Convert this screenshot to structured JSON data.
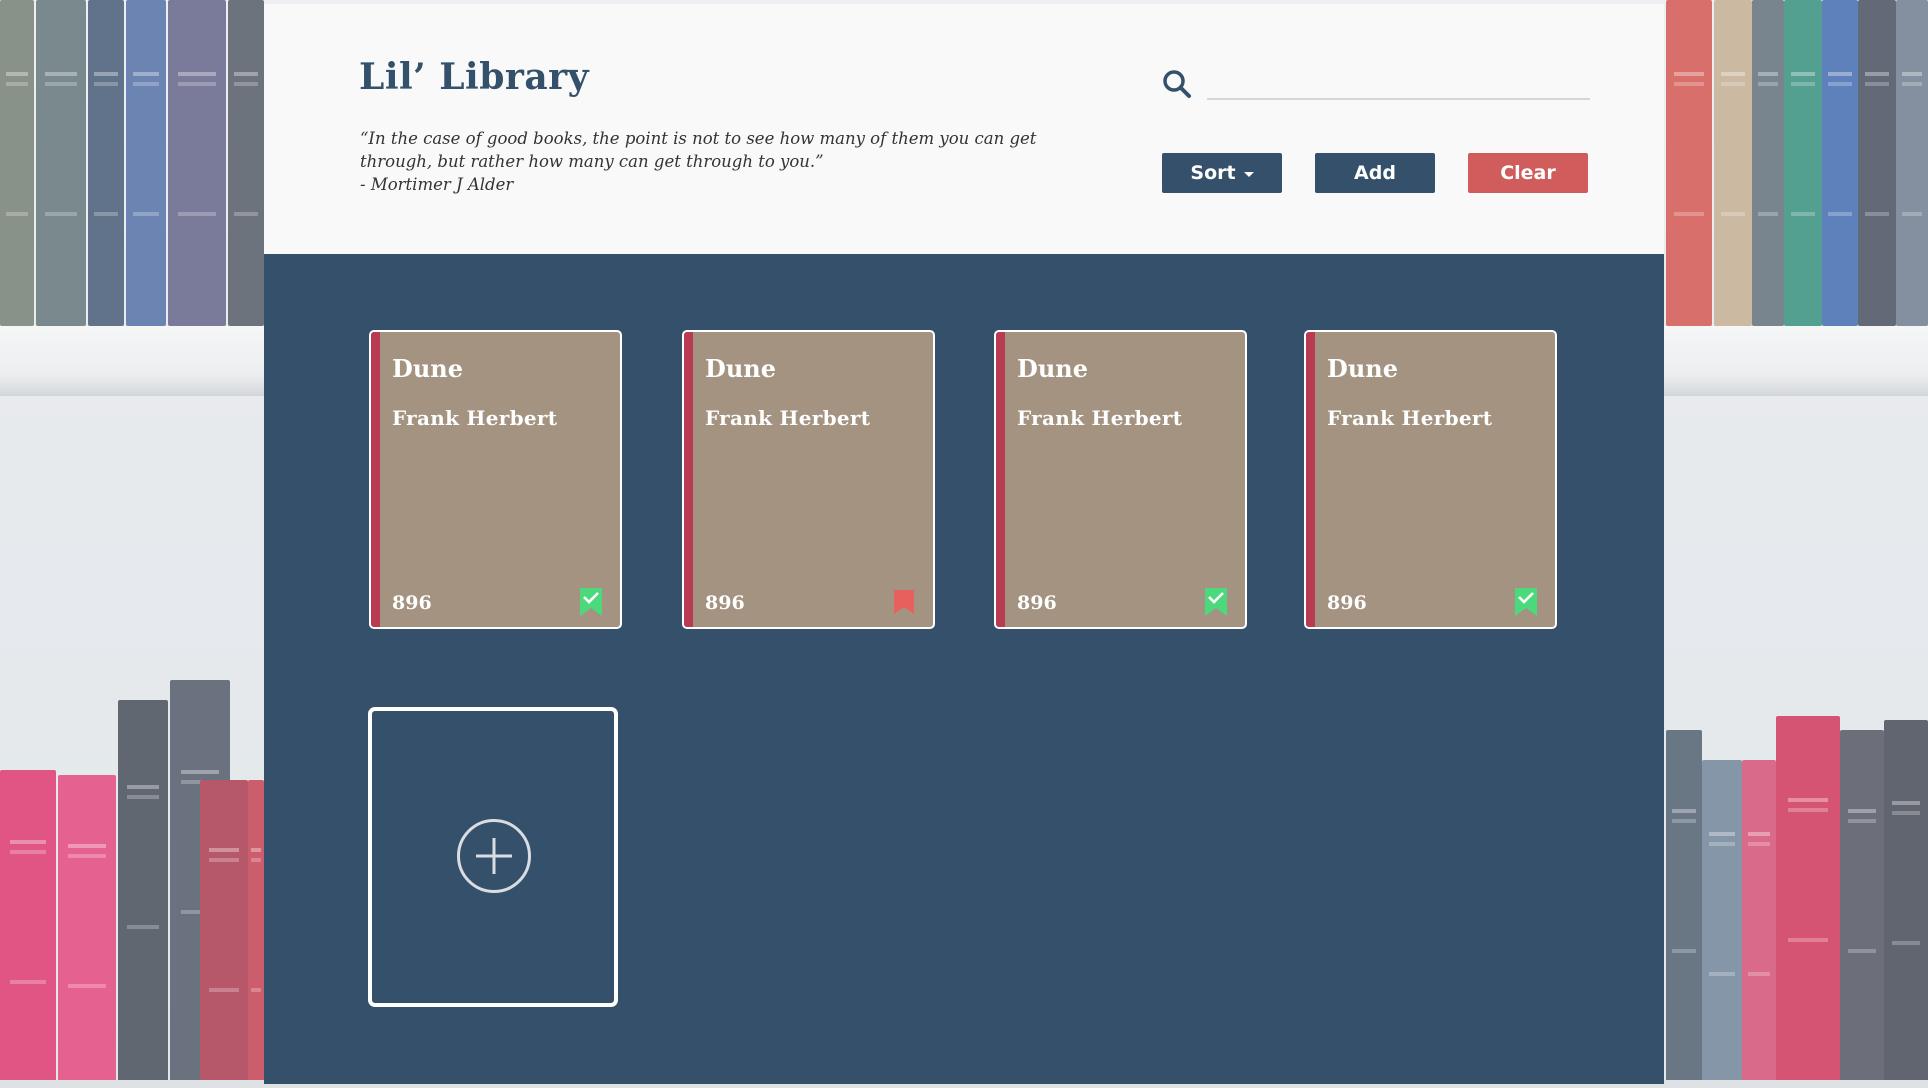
{
  "app": {
    "title": "Lil’ Library",
    "quote_lines": [
      "“In the case of good books, the point is not to see how many of them you can get",
      "through, but rather how many can get through to you.”",
      "- Mortimer J Alder"
    ]
  },
  "search": {
    "value": "",
    "placeholder": ""
  },
  "toolbar": {
    "sort_label": "Sort",
    "add_label": "Add",
    "clear_label": "Clear"
  },
  "books": [
    {
      "title": "Dune",
      "author": "Frank Herbert",
      "pages": "896",
      "status": "read",
      "status_color": "#4cd97b"
    },
    {
      "title": "Dune",
      "author": "Frank Herbert",
      "pages": "896",
      "status": "unread",
      "status_color": "#e8605d"
    },
    {
      "title": "Dune",
      "author": "Frank Herbert",
      "pages": "896",
      "status": "read",
      "status_color": "#4cd97b"
    },
    {
      "title": "Dune",
      "author": "Frank Herbert",
      "pages": "896",
      "status": "read",
      "status_color": "#4cd97b"
    }
  ],
  "icons": {
    "search": "search-icon",
    "sort_caret": "caret-down-icon",
    "read_status": "bookmark-check-icon",
    "unread_status": "bookmark-icon",
    "add_book": "plus-circle-icon"
  },
  "colors": {
    "primary": "#34506a",
    "danger": "#d05d5b",
    "card": "#a39380",
    "spine": "#b93a53",
    "header_bg": "#f9f9f9"
  }
}
